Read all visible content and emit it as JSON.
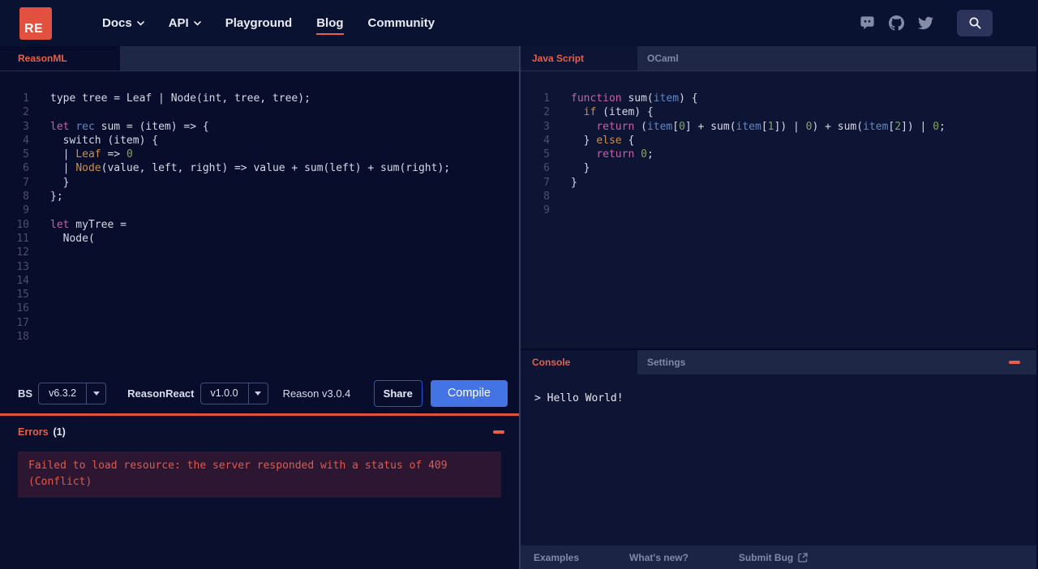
{
  "nav": {
    "logo_text": "RE",
    "items": [
      {
        "label": "Docs",
        "chevron": true
      },
      {
        "label": "API",
        "chevron": true
      },
      {
        "label": "Playground",
        "chevron": false
      },
      {
        "label": "Blog",
        "chevron": false,
        "active": true
      },
      {
        "label": "Community",
        "chevron": false
      }
    ],
    "social_icons": [
      "discord-icon",
      "github-icon",
      "twitter-icon"
    ],
    "search_icon": "magnifier"
  },
  "left": {
    "tab_label": "ReasonML",
    "code": [
      [
        [
          "p",
          "type tree = Leaf | Node(int, tree, tree);"
        ]
      ],
      [],
      [
        [
          "k",
          "let"
        ],
        [
          "p",
          " "
        ],
        [
          "b",
          "rec"
        ],
        [
          "p",
          " sum = (item) => {"
        ]
      ],
      [
        [
          "p",
          "  switch (item) {"
        ]
      ],
      [
        [
          "p",
          "  | "
        ],
        [
          "o",
          "Leaf"
        ],
        [
          "p",
          " => "
        ],
        [
          "g",
          "0"
        ]
      ],
      [
        [
          "p",
          "  | "
        ],
        [
          "o",
          "Node"
        ],
        [
          "p",
          "(value, left, right) => value + sum(left) + sum(right);"
        ]
      ],
      [
        [
          "p",
          "  }"
        ]
      ],
      [
        [
          "p",
          "};"
        ]
      ],
      [],
      [
        [
          "k",
          "let"
        ],
        [
          "p",
          " myTree ="
        ]
      ],
      [
        [
          "p",
          "  Node("
        ]
      ],
      [],
      [],
      [],
      [],
      [],
      [],
      []
    ],
    "toolbar": {
      "bs_label": "BS",
      "bs_version": "v6.3.2",
      "reasonreact_label": "ReasonReact",
      "reasonreact_version": "v1.0.0",
      "reason_version": "Reason v3.0.4",
      "share_label": "Share",
      "compile_label": "Compile"
    },
    "errors": {
      "title": "Errors",
      "count": "(1)",
      "message": "Failed to load resource: the server responded with a status of 409 (Conflict)",
      "collapse_icon": "minus-bar"
    }
  },
  "right": {
    "tabs": [
      "Java Script",
      "OCaml"
    ],
    "code": [
      [
        [
          "k",
          "function"
        ],
        [
          "p",
          " sum("
        ],
        [
          "b",
          "item"
        ],
        [
          "p",
          ") {"
        ]
      ],
      [
        [
          "p",
          "  "
        ],
        [
          "o",
          "if"
        ],
        [
          "p",
          " (item) {"
        ]
      ],
      [
        [
          "p",
          "    "
        ],
        [
          "k",
          "return"
        ],
        [
          "p",
          " ("
        ],
        [
          "b",
          "item"
        ],
        [
          "p",
          "["
        ],
        [
          "g",
          "0"
        ],
        [
          "p",
          "] + sum("
        ],
        [
          "b",
          "item"
        ],
        [
          "p",
          "["
        ],
        [
          "g",
          "1"
        ],
        [
          "p",
          "]) | "
        ],
        [
          "g",
          "0"
        ],
        [
          "p",
          ") + sum("
        ],
        [
          "b",
          "item"
        ],
        [
          "p",
          "["
        ],
        [
          "g",
          "2"
        ],
        [
          "p",
          "]) | "
        ],
        [
          "g",
          "0"
        ],
        [
          "p",
          ";"
        ]
      ],
      [
        [
          "p",
          "  } "
        ],
        [
          "o",
          "else"
        ],
        [
          "p",
          " {"
        ]
      ],
      [
        [
          "p",
          "    "
        ],
        [
          "k",
          "return"
        ],
        [
          "p",
          " "
        ],
        [
          "g",
          "0"
        ],
        [
          "p",
          ";"
        ]
      ],
      [
        [
          "p",
          "  }"
        ]
      ],
      [
        [
          "p",
          "}"
        ]
      ],
      [],
      []
    ],
    "console": {
      "tabs": [
        "Console",
        "Settings"
      ],
      "output": "> Hello World!",
      "collapse_icon": "minus-bar"
    },
    "footer": {
      "examples": "Examples",
      "whats_new": "What's new?",
      "submit_bug": "Submit Bug",
      "submit_bug_icon": "external-link"
    }
  },
  "colors": {
    "accent_red": "#e8604a",
    "logo_red": "#e2503f",
    "compile_blue": "#4474e4",
    "nav_bg": "#0a1231",
    "left_editor_bg": "#070d2a",
    "right_editor_bg": "#0e1434",
    "error_box_bg": "#2c1631",
    "keyword_pink": "#c365a0",
    "ident_blue": "#6089c4",
    "variant_orange": "#c98e52",
    "number_green": "#83a45f"
  }
}
